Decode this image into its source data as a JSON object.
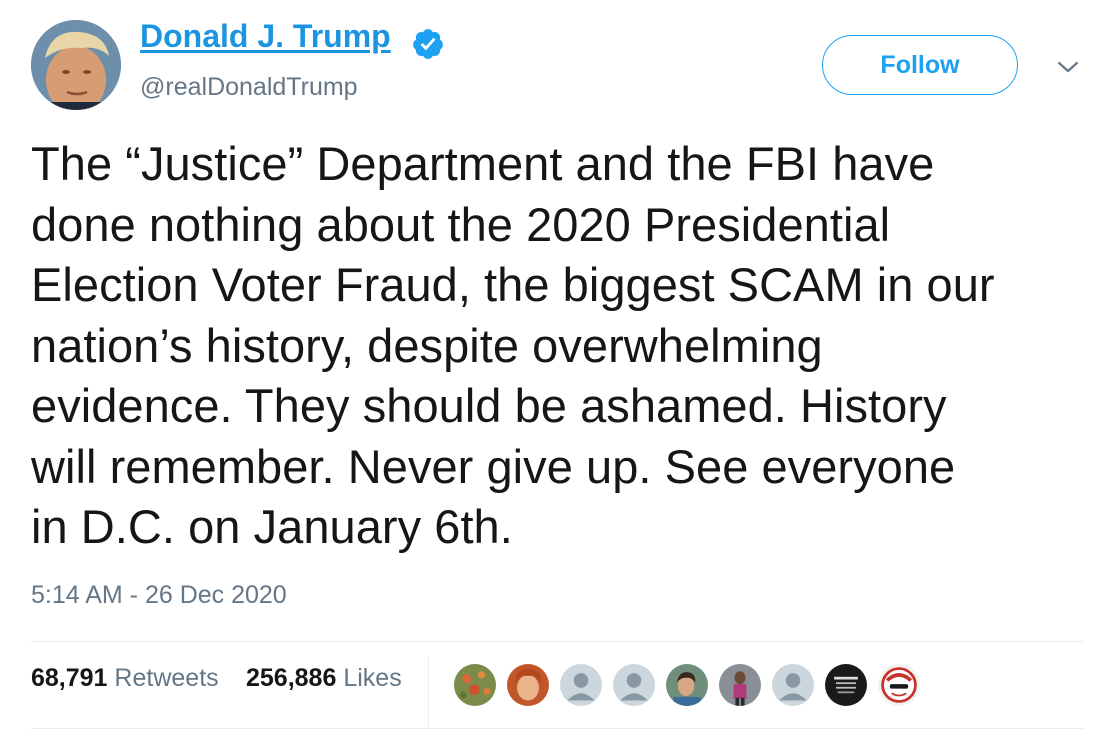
{
  "author": {
    "display_name": "Donald J. Trump",
    "handle": "@realDonaldTrump",
    "verified": true
  },
  "actions": {
    "follow_label": "Follow"
  },
  "tweet": {
    "text": "The “Justice” Department and the FBI have\ndone nothing about the 2020 Presidential\nElection Voter Fraud, the biggest SCAM in our\nnation’s history, despite overwhelming\nevidence. They should be ashamed. History\nwill remember. Never give up. See everyone\nin D.C. on January 6th.",
    "timestamp": "5:14 AM - 26 Dec 2020"
  },
  "stats": {
    "retweets_count": "68,791",
    "retweets_label": "Retweets",
    "likes_count": "256,886",
    "likes_label": "Likes"
  },
  "colors": {
    "link_blue": "#1b95e0",
    "follow_blue": "#1da1f2",
    "secondary_text": "#657786",
    "divider": "#e6ecf0"
  },
  "icons": {
    "verified": "verified-badge-icon",
    "caret": "chevron-down-icon"
  }
}
